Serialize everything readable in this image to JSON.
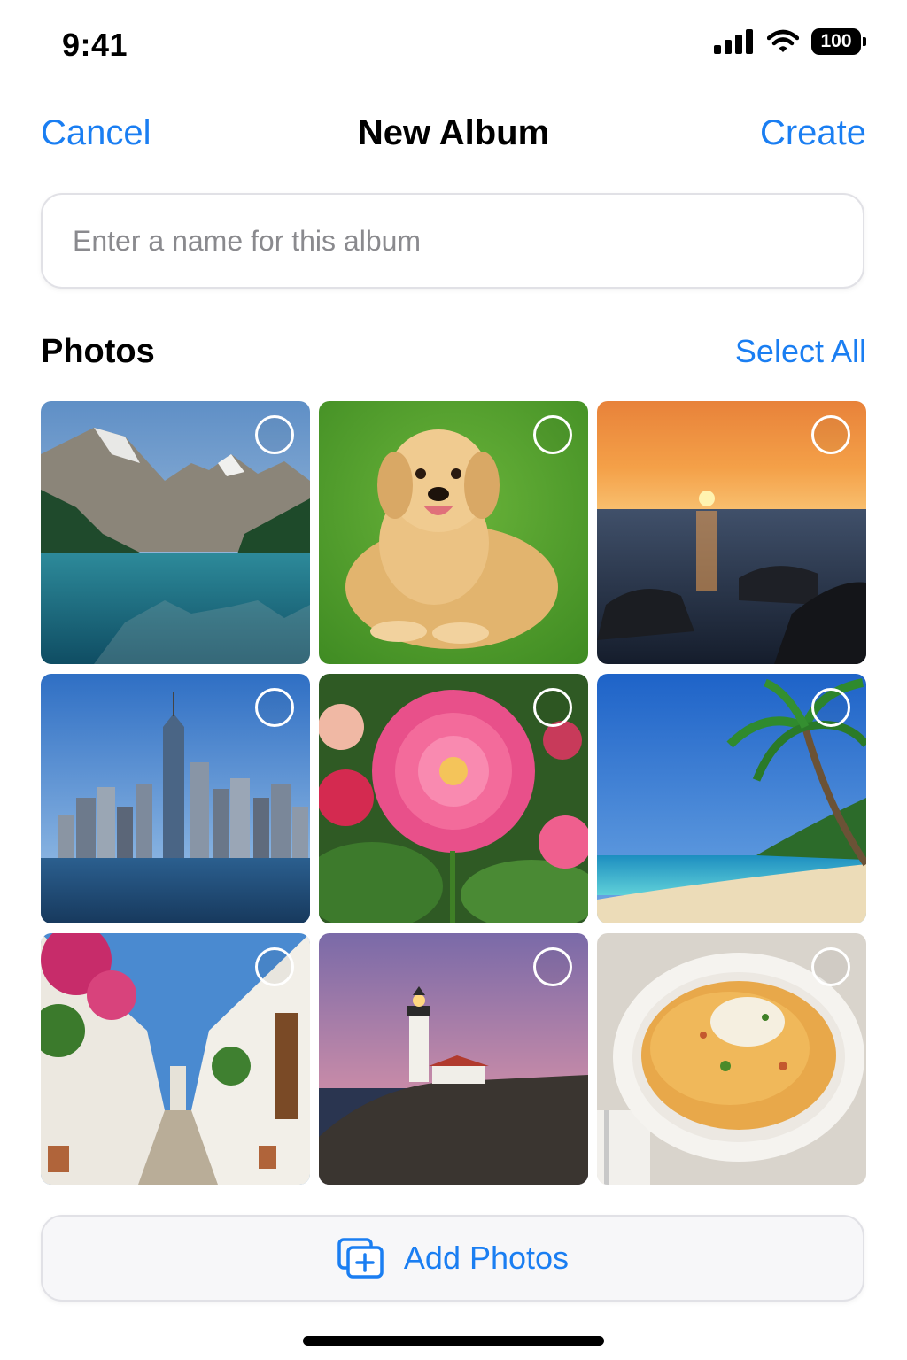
{
  "status_bar": {
    "time": "9:41",
    "battery": "100",
    "icons": [
      "signal-icon",
      "wifi-icon",
      "battery-icon"
    ]
  },
  "nav": {
    "cancel": "Cancel",
    "title": "New Album",
    "create": "Create"
  },
  "album_name": {
    "placeholder": "Enter a name for this album",
    "value": ""
  },
  "photos_section": {
    "title": "Photos",
    "select_all": "Select All",
    "items": [
      {
        "subject": "mountain-lake",
        "selected": false
      },
      {
        "subject": "golden-retriever",
        "selected": false
      },
      {
        "subject": "ocean-sunset",
        "selected": false
      },
      {
        "subject": "city-skyline",
        "selected": false
      },
      {
        "subject": "pink-dahlia",
        "selected": false
      },
      {
        "subject": "palm-beach",
        "selected": false
      },
      {
        "subject": "flower-alley",
        "selected": false
      },
      {
        "subject": "lighthouse-dusk",
        "selected": false
      },
      {
        "subject": "pasta-bowl",
        "selected": false
      }
    ]
  },
  "add_photos": {
    "label": "Add Photos"
  },
  "colors": {
    "accent": "#1a7ef2",
    "placeholder": "#8a8a8e",
    "border": "#e1e1e6"
  }
}
